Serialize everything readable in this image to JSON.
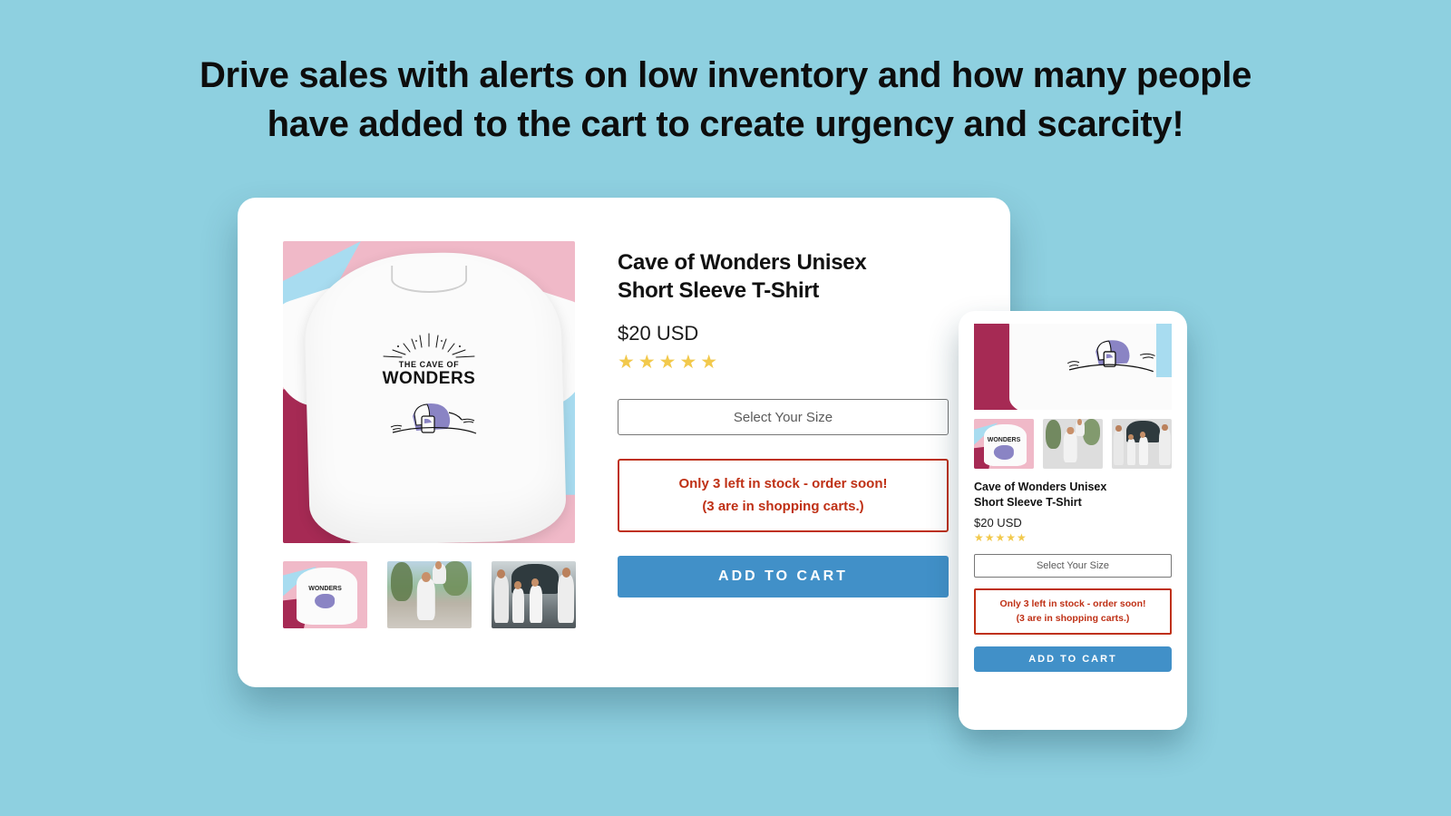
{
  "headline": {
    "line1": "Drive sales with alerts on low inventory and how many people",
    "line2_prefix": "have added to the cart to create ",
    "line2_emphasis": "urgency and scarcity!"
  },
  "theme": {
    "background": "#8ed0e0",
    "card_background": "#ffffff",
    "button_blue": "#4190c8",
    "alert_red": "#bf3015",
    "star_gold": "#f2c94c",
    "select_border": "#777777",
    "placeholder_text": "#5a5a5a"
  },
  "product": {
    "title_line1": "Cave of Wonders Unisex",
    "title_line2": "Short Sleeve T-Shirt",
    "title_full": "Cave of Wonders Unisex Short Sleeve T-Shirt",
    "price": "$20 USD",
    "rating_stars": "★★★★★",
    "rating_value": 5,
    "rating_max": 5,
    "size_select_label": "Select Your Size",
    "stock_alert_line1": "Only 3 left in stock - order soon!",
    "stock_alert_line2": "(3 are in shopping carts.)",
    "stock_remaining": 3,
    "carts_count": 3,
    "add_to_cart_label": "ADD TO CART",
    "shirt_art_line1": "THE CAVE OF",
    "shirt_art_line2": "WONDERS"
  },
  "gallery": {
    "main_alt": "White t-shirt with Cave of Wonders graphic on pink and blue background",
    "thumbnails": [
      {
        "alt": "White Cave of Wonders t-shirt flat lay"
      },
      {
        "alt": "Father carrying daughter on shoulders outdoors wearing the shirt"
      },
      {
        "alt": "Family wearing matching shirts beside a vehicle"
      }
    ]
  },
  "mobile_preview": {
    "main_alt": "Close-up crop of the Cave of Wonders t-shirt graphic",
    "thumbnails": [
      {
        "alt": "White Cave of Wonders t-shirt flat lay"
      },
      {
        "alt": "Father carrying daughter on shoulders outdoors wearing the shirt"
      },
      {
        "alt": "Family wearing matching shirts beside a vehicle"
      }
    ]
  }
}
